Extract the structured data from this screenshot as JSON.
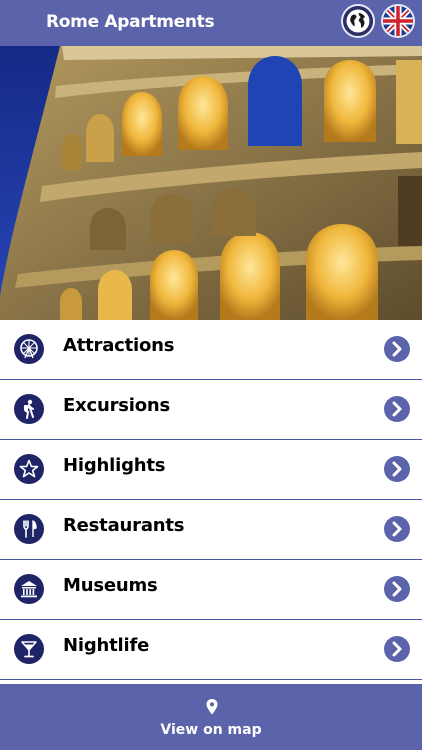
{
  "header": {
    "title": "Rome Apartments",
    "globe_icon": "globe-icon",
    "language_icon": "uk-flag-icon"
  },
  "hero": {
    "image": "colosseum-photo",
    "sky_color": "#1c2f8e",
    "stone_color": "#e8c46a"
  },
  "menu": {
    "items": [
      {
        "label": "Attractions",
        "icon": "ferris-wheel-icon"
      },
      {
        "label": "Excursions",
        "icon": "hiker-icon"
      },
      {
        "label": "Highlights",
        "icon": "star-icon"
      },
      {
        "label": "Restaurants",
        "icon": "fork-knife-icon"
      },
      {
        "label": "Museums",
        "icon": "museum-icon"
      },
      {
        "label": "Nightlife",
        "icon": "cocktail-icon"
      }
    ],
    "chevron_icon": "chevron-right-icon"
  },
  "footer": {
    "label": "View on map",
    "icon": "map-pin-icon"
  },
  "colors": {
    "accent": "#5b63aa",
    "icon_bg": "#1f2466",
    "divider": "#4c55a0"
  }
}
